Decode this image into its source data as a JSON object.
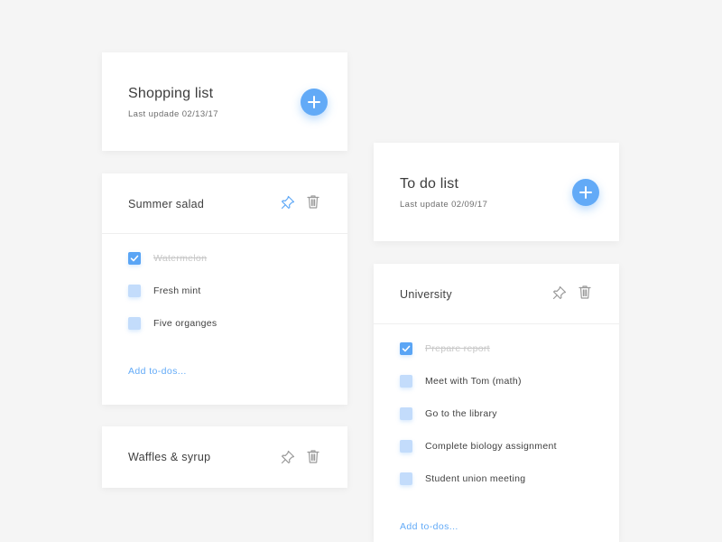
{
  "colors": {
    "accent": "#62aaf7",
    "checked": "#5aa5f5",
    "unchecked": "#c3dcfb",
    "background": "#f5f5f5"
  },
  "shopping": {
    "title": "Shopping list",
    "last_update": "Last updade 02/13/17",
    "add_icon": "plus-icon",
    "sections": [
      {
        "title": "Summer salad",
        "pin_icon": "pin-icon",
        "delete_icon": "trash-icon",
        "items": [
          {
            "label": "Watermelon",
            "checked": true
          },
          {
            "label": "Fresh mint",
            "checked": false
          },
          {
            "label": "Five organges",
            "checked": false
          }
        ],
        "add_label": "Add to-dos..."
      },
      {
        "title": "Waffles & syrup",
        "pin_icon": "pin-icon",
        "delete_icon": "trash-icon"
      }
    ]
  },
  "todo": {
    "title": "To do list",
    "last_update": "Last update 02/09/17",
    "add_icon": "plus-icon",
    "sections": [
      {
        "title": "University",
        "pin_icon": "pin-icon",
        "delete_icon": "trash-icon",
        "items": [
          {
            "label": "Prepare report",
            "checked": true
          },
          {
            "label": "Meet with Tom (math)",
            "checked": false
          },
          {
            "label": "Go to the library",
            "checked": false
          },
          {
            "label": "Complete biology assignment",
            "checked": false
          },
          {
            "label": "Student union meeting",
            "checked": false
          }
        ],
        "add_label": "Add to-dos..."
      }
    ]
  }
}
